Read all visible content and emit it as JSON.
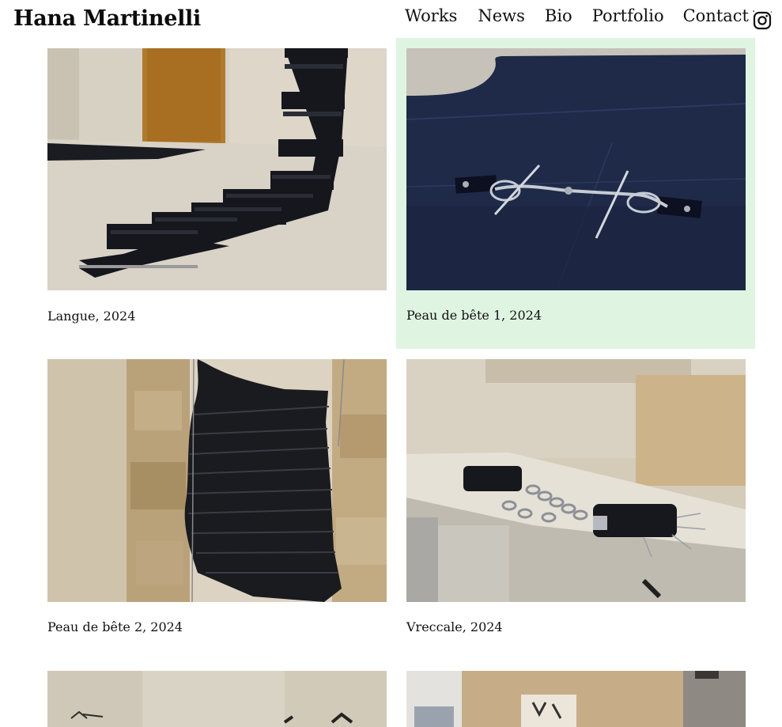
{
  "header": {
    "site_title": "Hana Martinelli",
    "nav": [
      {
        "label": "Works"
      },
      {
        "label": "News"
      },
      {
        "label": "Bio"
      },
      {
        "label": "Portfolio"
      },
      {
        "label": "Contact"
      }
    ],
    "social_icon": "instagram-icon"
  },
  "works": [
    {
      "caption": "Langue, 2024",
      "highlighted": false
    },
    {
      "caption": "Peau de bête 1, 2024",
      "highlighted": true
    },
    {
      "caption": "Peau de bête 2, 2024",
      "highlighted": false
    },
    {
      "caption": "Vreccale, 2024",
      "highlighted": false
    },
    {
      "caption": "",
      "highlighted": false
    },
    {
      "caption": "",
      "highlighted": false
    }
  ],
  "colors": {
    "highlight_background": "#dff5e2",
    "text": "#111111",
    "page_background": "#ffffff"
  }
}
